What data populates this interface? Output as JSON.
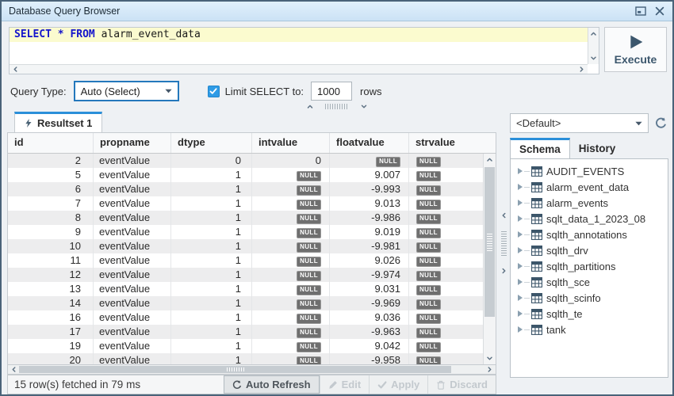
{
  "window": {
    "title": "Database Query Browser"
  },
  "sql_editor": {
    "keywords": "SELECT * FROM",
    "table_ref": "alarm_event_data"
  },
  "execute_button": {
    "label": "Execute"
  },
  "query_bar": {
    "type_label": "Query Type:",
    "type_value": "Auto (Select)",
    "limit_checked": true,
    "limit_label": "Limit SELECT to:",
    "limit_value": "1000",
    "rows_suffix": "rows"
  },
  "resultset": {
    "tab_label": "Resultset 1",
    "null_text": "NULL",
    "columns": [
      "id",
      "propname",
      "dtype",
      "intvalue",
      "floatvalue",
      "strvalue"
    ],
    "rows": [
      [
        2,
        "eventValue",
        0,
        0,
        null,
        null
      ],
      [
        5,
        "eventValue",
        1,
        null,
        "9.007",
        null
      ],
      [
        6,
        "eventValue",
        1,
        null,
        "-9.993",
        null
      ],
      [
        7,
        "eventValue",
        1,
        null,
        "9.013",
        null
      ],
      [
        8,
        "eventValue",
        1,
        null,
        "-9.986",
        null
      ],
      [
        9,
        "eventValue",
        1,
        null,
        "9.019",
        null
      ],
      [
        10,
        "eventValue",
        1,
        null,
        "-9.981",
        null
      ],
      [
        11,
        "eventValue",
        1,
        null,
        "9.026",
        null
      ],
      [
        12,
        "eventValue",
        1,
        null,
        "-9.974",
        null
      ],
      [
        13,
        "eventValue",
        1,
        null,
        "9.031",
        null
      ],
      [
        14,
        "eventValue",
        1,
        null,
        "-9.969",
        null
      ],
      [
        16,
        "eventValue",
        1,
        null,
        "9.036",
        null
      ],
      [
        17,
        "eventValue",
        1,
        null,
        "-9.963",
        null
      ],
      [
        19,
        "eventValue",
        1,
        null,
        "9.042",
        null
      ],
      [
        20,
        "eventValue",
        1,
        null,
        "-9.958",
        null
      ]
    ]
  },
  "status_bar": {
    "message": "15 row(s) fetched in 79 ms",
    "buttons": [
      {
        "label": "Auto Refresh",
        "icon": "refresh",
        "enabled": true
      },
      {
        "label": "Edit",
        "icon": "pencil",
        "enabled": false
      },
      {
        "label": "Apply",
        "icon": "check",
        "enabled": false
      },
      {
        "label": "Discard",
        "icon": "trash",
        "enabled": false
      }
    ]
  },
  "schema_panel": {
    "datasource_value": "<Default>",
    "tabs": [
      {
        "label": "Schema",
        "active": true
      },
      {
        "label": "History",
        "active": false
      }
    ],
    "tables": [
      "AUDIT_EVENTS",
      "alarm_event_data",
      "alarm_events",
      "sqlt_data_1_2023_08",
      "sqlth_annotations",
      "sqlth_drv",
      "sqlth_partitions",
      "sqlth_sce",
      "sqlth_scinfo",
      "sqlth_te",
      "tank"
    ]
  },
  "colors": {
    "accent_blue": "#2b8fd9",
    "checkbox_blue": "#2e9be6",
    "keyword_blue": "#1414cc",
    "slate": "#3c576d",
    "null_badge_bg": "#6f6f6f",
    "titlebar_bg": "#d6e9f9",
    "row_stripe": "#ededee"
  }
}
